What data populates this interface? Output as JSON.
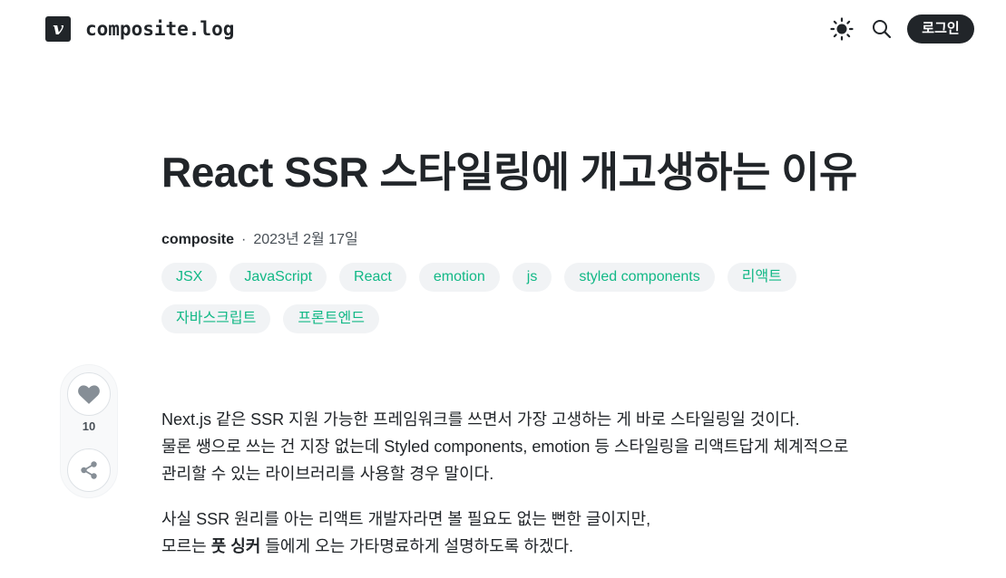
{
  "header": {
    "logo_letter": "v",
    "blog_name": "composite.log",
    "login_label": "로그인"
  },
  "post": {
    "title": "React SSR 스타일링에 개고생하는 이유",
    "author": "composite",
    "separator": "·",
    "date": "2023년 2월 17일",
    "tags": [
      "JSX",
      "JavaScript",
      "React",
      "emotion",
      "js",
      "styled components",
      "리액트",
      "자바스크립트",
      "프론트엔드"
    ],
    "likes": "10",
    "paragraph1": [
      "Next.js 같은 SSR 지원 가능한 프레임워크를 쓰면서 가장 고생하는 게 바로 스타일링일 것이다.",
      "물론 쌩으로 쓰는 건 지장 없는데 Styled components, emotion 등 스타일링을 리액트답게 체계적으로",
      "관리할 수 있는 라이브러리를 사용할 경우 말이다."
    ],
    "paragraph2_line1": "사실 SSR 원리를 아는 리액트 개발자라면 볼 필요도 없는 뻔한 글이지만,",
    "paragraph2_line2_a": "모르는 ",
    "paragraph2_line2_bold": "풋 싱커",
    "paragraph2_line2_b": " 들에게 오는 가타명료하게 설명하도록 하겠다."
  },
  "icons": {
    "theme": "sun-icon",
    "search": "search-icon",
    "like": "heart-icon",
    "share": "share-icon"
  },
  "colors": {
    "accent": "#12b886",
    "dark": "#212529",
    "tag_bg": "#f1f3f5"
  }
}
